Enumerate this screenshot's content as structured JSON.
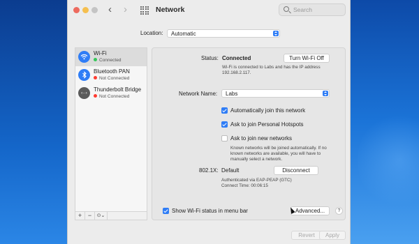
{
  "window": {
    "title": "Network",
    "search_placeholder": "Search"
  },
  "location": {
    "label": "Location:",
    "value": "Automatic"
  },
  "services": [
    {
      "name": "Wi-Fi",
      "status": "Connected",
      "status_color": "#34c759",
      "icon": "wifi-icon"
    },
    {
      "name": "Bluetooth PAN",
      "status": "Not Connected",
      "status_color": "#ff3b30",
      "icon": "bluetooth-icon"
    },
    {
      "name": "Thunderbolt Bridge",
      "status": "Not Connected",
      "status_color": "#ff3b30",
      "icon": "thunderbolt-bridge-icon"
    }
  ],
  "sidebar_toolbar": {
    "add": "+",
    "remove": "−",
    "action": "⊙⌄"
  },
  "detail": {
    "status_label": "Status:",
    "status_value": "Connected",
    "turn_off_button": "Turn Wi-Fi Off",
    "status_desc": "Wi-Fi is connected to Labs and has the IP address 192.168.2.117.",
    "network_name_label": "Network Name:",
    "network_name_value": "Labs",
    "options": [
      {
        "label": "Automatically join this network",
        "checked": true
      },
      {
        "label": "Ask to join Personal Hotspots",
        "checked": true
      },
      {
        "label": "Ask to join new networks",
        "checked": false
      }
    ],
    "new_networks_desc": "Known networks will be joined automatically. If no known networks are available, you will have to manually select a network.",
    "dot1x_label": "802.1X:",
    "dot1x_value": "Default",
    "disconnect_button": "Disconnect",
    "auth_line1": "Authenticated via EAP-PEAP (GTC)",
    "auth_line2": "Connect Time: 00:06:15",
    "show_status_label": "Show Wi-Fi status in menu bar",
    "show_status_checked": true,
    "advanced_button": "Advanced...",
    "help": "?"
  },
  "footer": {
    "revert": "Revert",
    "apply": "Apply"
  },
  "colors": {
    "accent": "#2f7df6",
    "connected": "#34c759",
    "not_connected": "#ff3b30"
  }
}
